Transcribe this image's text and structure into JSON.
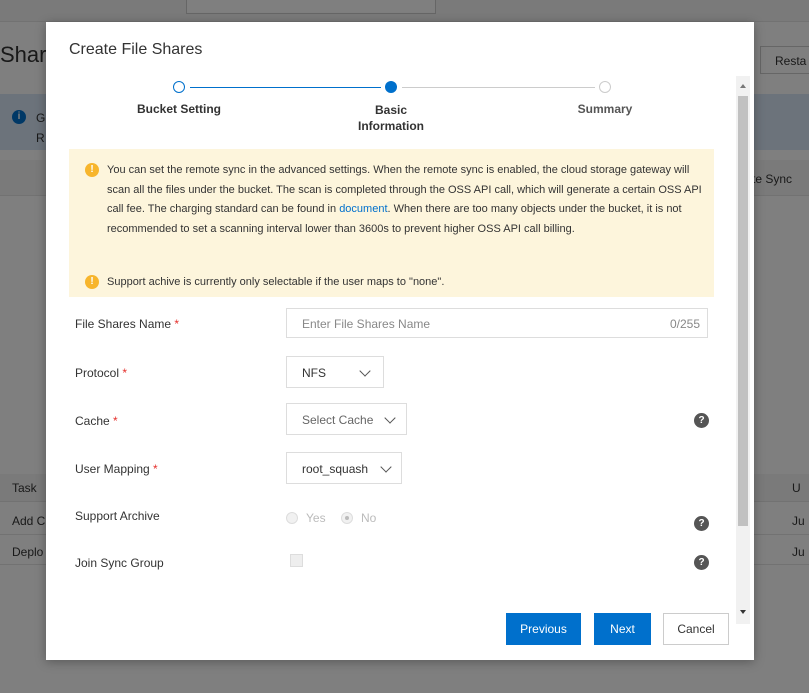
{
  "background": {
    "page_title": "Shar",
    "restart_button": "Resta",
    "info_text_line1": "G",
    "info_text_line2": "R",
    "col_right_header": "te Sync",
    "task_header": "Task",
    "task_header_right": "U",
    "rows": [
      {
        "left": "Add C",
        "right": "Ju"
      },
      {
        "left": "Deplo",
        "right": "Ju"
      }
    ]
  },
  "dialog": {
    "title": "Create File Shares",
    "steps": [
      {
        "label": "Bucket Setting",
        "status": "done"
      },
      {
        "label_line1": "Basic",
        "label_line2": "Information",
        "status": "current"
      },
      {
        "label": "Summary",
        "status": "pending"
      }
    ],
    "notice": {
      "text_before_link": "You can set the remote sync in the advanced settings. When the remote sync is enabled, the cloud storage gateway will scan all the files under the bucket. The scan is completed through the OSS API call, which will generate a certain OSS API call fee. The charging standard can be found in ",
      "link_text": "document",
      "text_after_link": ". When there are too many objects under the bucket, it is not recommended to set a scanning interval lower than 3600s to prevent higher OSS API call billing.",
      "text2": "Support achive is currently only selectable if the user maps to \"none\"."
    },
    "form": {
      "file_shares_name": {
        "label": "File Shares Name",
        "placeholder": "Enter File Shares Name",
        "count": "0/255",
        "value": ""
      },
      "protocol": {
        "label": "Protocol",
        "value": "NFS"
      },
      "cache": {
        "label": "Cache",
        "placeholder": "Select Cache"
      },
      "user_mapping": {
        "label": "User Mapping",
        "value": "root_squash"
      },
      "support_archive": {
        "label": "Support Archive",
        "options": [
          "Yes",
          "No"
        ],
        "selected": "No",
        "disabled": true
      },
      "join_sync_group": {
        "label": "Join Sync Group",
        "checked": false,
        "disabled": true
      }
    },
    "required_mark": "*",
    "buttons": {
      "previous": "Previous",
      "next": "Next",
      "cancel": "Cancel"
    }
  },
  "colors": {
    "primary": "#0070cc",
    "warning": "#f7b52c",
    "notice_bg": "#fdf5dc",
    "required": "#e5302c"
  }
}
